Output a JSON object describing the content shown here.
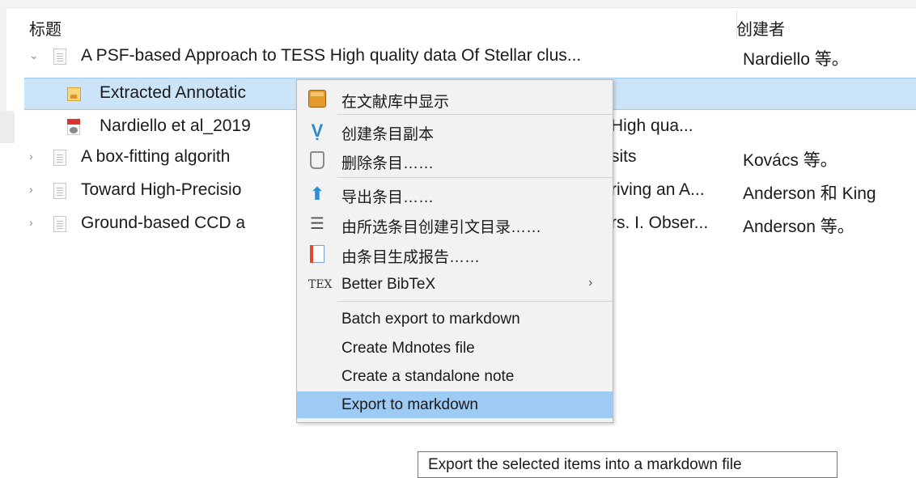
{
  "table": {
    "header": {
      "title_col": "标题",
      "creator_col": "创建者"
    },
    "rows": [
      {
        "twisty": "⌄",
        "icon": "document-icon",
        "title": "A PSF-based Approach to TESS High quality data Of Stellar clus...",
        "creator": "Nardiello 等。"
      },
      {
        "icon": "note-icon",
        "title": "Extracted Annotatic",
        "creator": ""
      },
      {
        "icon": "pdf-icon",
        "title": "Nardiello et al_2019",
        "title_tail": "High qua...",
        "creator": ""
      },
      {
        "twisty": "›",
        "icon": "document-icon",
        "title": "A box-fitting algorith",
        "title_tail": "sits",
        "creator": "Kovács 等。"
      },
      {
        "twisty": "›",
        "icon": "document-icon",
        "title": "Toward High-Precisio",
        "title_tail": "riving an A...",
        "creator": "Anderson 和 King"
      },
      {
        "twisty": "›",
        "icon": "document-icon",
        "title": "Ground-based CCD a",
        "title_tail": "rs. I. Obser...",
        "creator": "Anderson 等。"
      }
    ]
  },
  "context_menu": {
    "items": [
      {
        "label": "在文献库中显示",
        "icon": "library-icon"
      },
      {
        "label": "创建条目副本",
        "icon": "duplicate-icon"
      },
      {
        "label": "删除条目……",
        "icon": "trash-icon"
      },
      {
        "label": "导出条目……",
        "icon": "export-icon"
      },
      {
        "label": "由所选条目创建引文目录……",
        "icon": "bibliography-icon"
      },
      {
        "label": "由条目生成报告……",
        "icon": "report-icon"
      },
      {
        "label": "Better BibTeX",
        "icon": "tex-icon",
        "submenu_arrow": "›"
      },
      {
        "label": "Batch export to markdown"
      },
      {
        "label": "Create Mdnotes file"
      },
      {
        "label": "Create a standalone note"
      },
      {
        "label": "Export to markdown",
        "active": true
      }
    ]
  },
  "icons": {
    "duplicate_glyph": "Ṿ",
    "export_glyph": "⬆",
    "bibliography_glyph": "☰",
    "tex_glyph": "TEX"
  },
  "tooltip": {
    "text": "Export the selected items into a markdown file"
  },
  "colors": {
    "selection": "#cce4f7",
    "menu_highlight": "#9dcbf3",
    "menu_background": "#f2f2f2"
  }
}
